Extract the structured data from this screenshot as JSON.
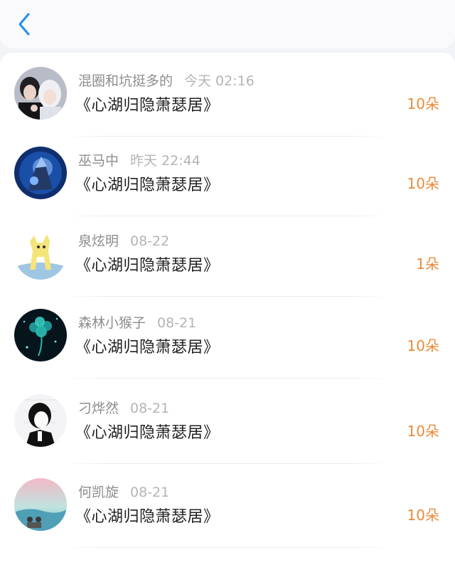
{
  "header": {
    "back_icon": "chevron-left-icon",
    "accent": "#2a8ff0"
  },
  "colors": {
    "amount": "#e98b3a",
    "name": "#8d8d8d",
    "time": "#b4b4b4",
    "title": "#222222"
  },
  "rows": [
    {
      "name": "混圈和坑挺多的",
      "time": "今天 02:16",
      "title": "《心湖归隐萧瑟居》",
      "amount": "10朵"
    },
    {
      "name": "巫马中",
      "time": "昨天 22:44",
      "title": "《心湖归隐萧瑟居》",
      "amount": "10朵"
    },
    {
      "name": "泉炫明",
      "time": "08-22",
      "title": "《心湖归隐萧瑟居》",
      "amount": "1朵"
    },
    {
      "name": "森林小猴子",
      "time": "08-21",
      "title": "《心湖归隐萧瑟居》",
      "amount": "10朵"
    },
    {
      "name": "刁烨然",
      "time": "08-21",
      "title": "《心湖归隐萧瑟居》",
      "amount": "10朵"
    },
    {
      "name": "何凯旋",
      "time": "08-21",
      "title": "《心湖归隐萧瑟居》",
      "amount": "10朵"
    }
  ]
}
